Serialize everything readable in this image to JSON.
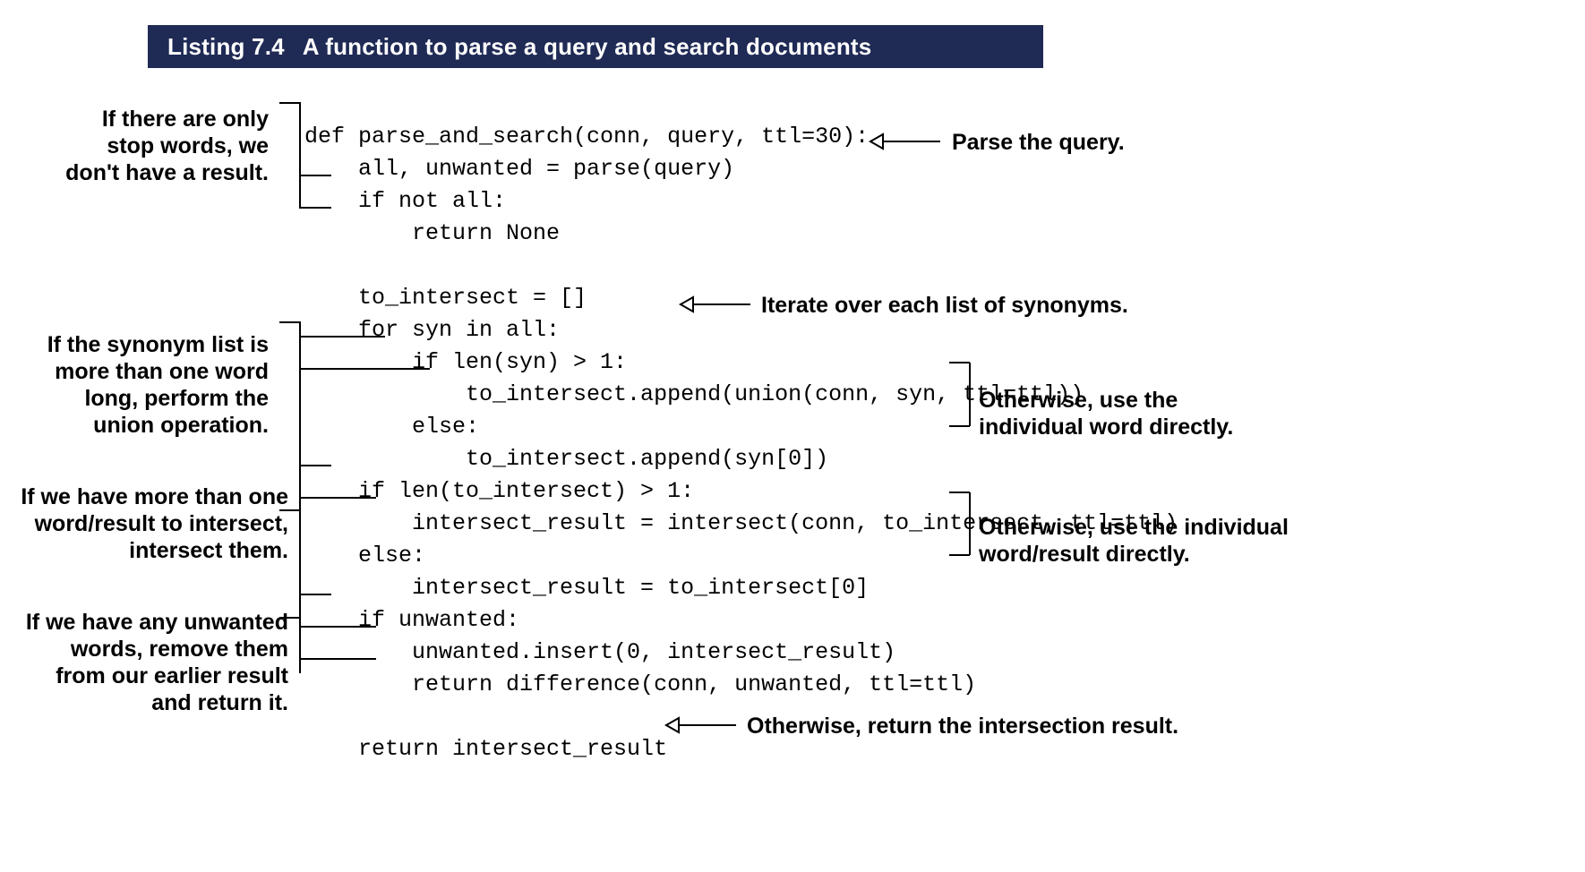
{
  "header": {
    "number": "Listing 7.4",
    "title": "A function to parse a query and search documents"
  },
  "code": "def parse_and_search(conn, query, ttl=30):\n    all, unwanted = parse(query)\n    if not all:\n        return None\n\n    to_intersect = []\n    for syn in all:\n        if len(syn) > 1:\n            to_intersect.append(union(conn, syn, ttl=ttl))\n        else:\n            to_intersect.append(syn[0])\n    if len(to_intersect) > 1:\n        intersect_result = intersect(conn, to_intersect, ttl=ttl)\n    else:\n        intersect_result = to_intersect[0]\n    if unwanted:\n        unwanted.insert(0, intersect_result)\n        return difference(conn, unwanted, ttl=ttl)\n\n    return intersect_result",
  "annotations": {
    "left1": "If there are only\nstop words, we\ndon't have a result.",
    "left2": "If the synonym list is\nmore than one word\nlong, perform the\nunion operation.",
    "left3": "If we have more than one\nword/result to intersect,\nintersect them.",
    "left4": "If we have any unwanted\nwords, remove them\nfrom our earlier result\nand return it.",
    "right1": "Parse the query.",
    "right2": "Iterate over each list of synonyms.",
    "right3": "Otherwise, use the\nindividual word directly.",
    "right4": "Otherwise, use the individual\nword/result directly.",
    "right5": "Otherwise, return the intersection result."
  }
}
